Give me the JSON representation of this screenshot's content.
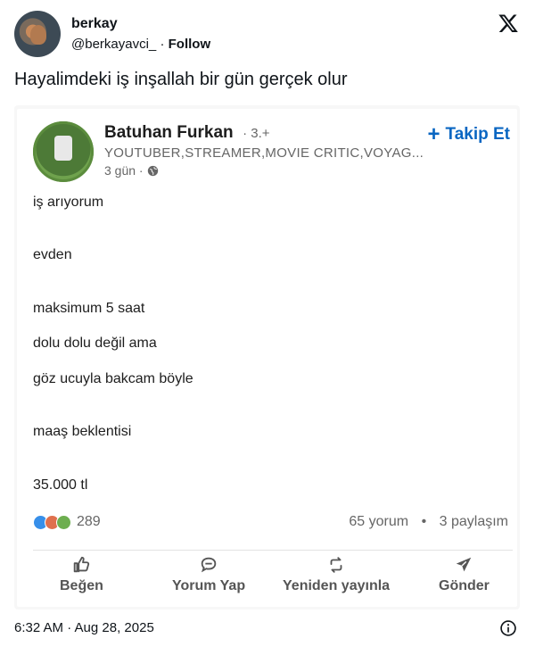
{
  "tweet": {
    "user_name": "berkay",
    "handle": "@berkayavci_",
    "separator": "·",
    "follow_label": "Follow",
    "text": "Hayalimdeki iş inşallah bir gün gerçek olur",
    "timestamp": "6:32 AM · Aug 28, 2025"
  },
  "linkedin_post": {
    "author_name": "Batuhan Furkan",
    "degree": "· 3.+",
    "headline": "YOUTUBER,STREAMER,MOVIE CRITIC,VOYAG...",
    "time": "3 gün ·",
    "follow_label": "Takip Et",
    "lines": [
      "iş arıyorum",
      "evden",
      "maksimum 5 saat",
      "dolu dolu değil ama",
      "göz ucuyla bakcam böyle",
      "maaş beklentisi",
      "35.000 tl"
    ],
    "reaction_count": "289",
    "comments": "65 yorum",
    "dot": "•",
    "shares": "3 paylaşım",
    "actions": {
      "like": "Beğen",
      "comment": "Yorum Yap",
      "repost": "Yeniden yayınla",
      "send": "Gönder"
    }
  },
  "colors": {
    "linkedin_blue": "#0a66c2",
    "text_primary": "#0f1419",
    "muted": "#666666"
  },
  "icons": [
    "x-logo-icon",
    "globe-icon",
    "plus-icon",
    "like-icon",
    "comment-icon",
    "repost-icon",
    "send-icon",
    "info-icon"
  ]
}
